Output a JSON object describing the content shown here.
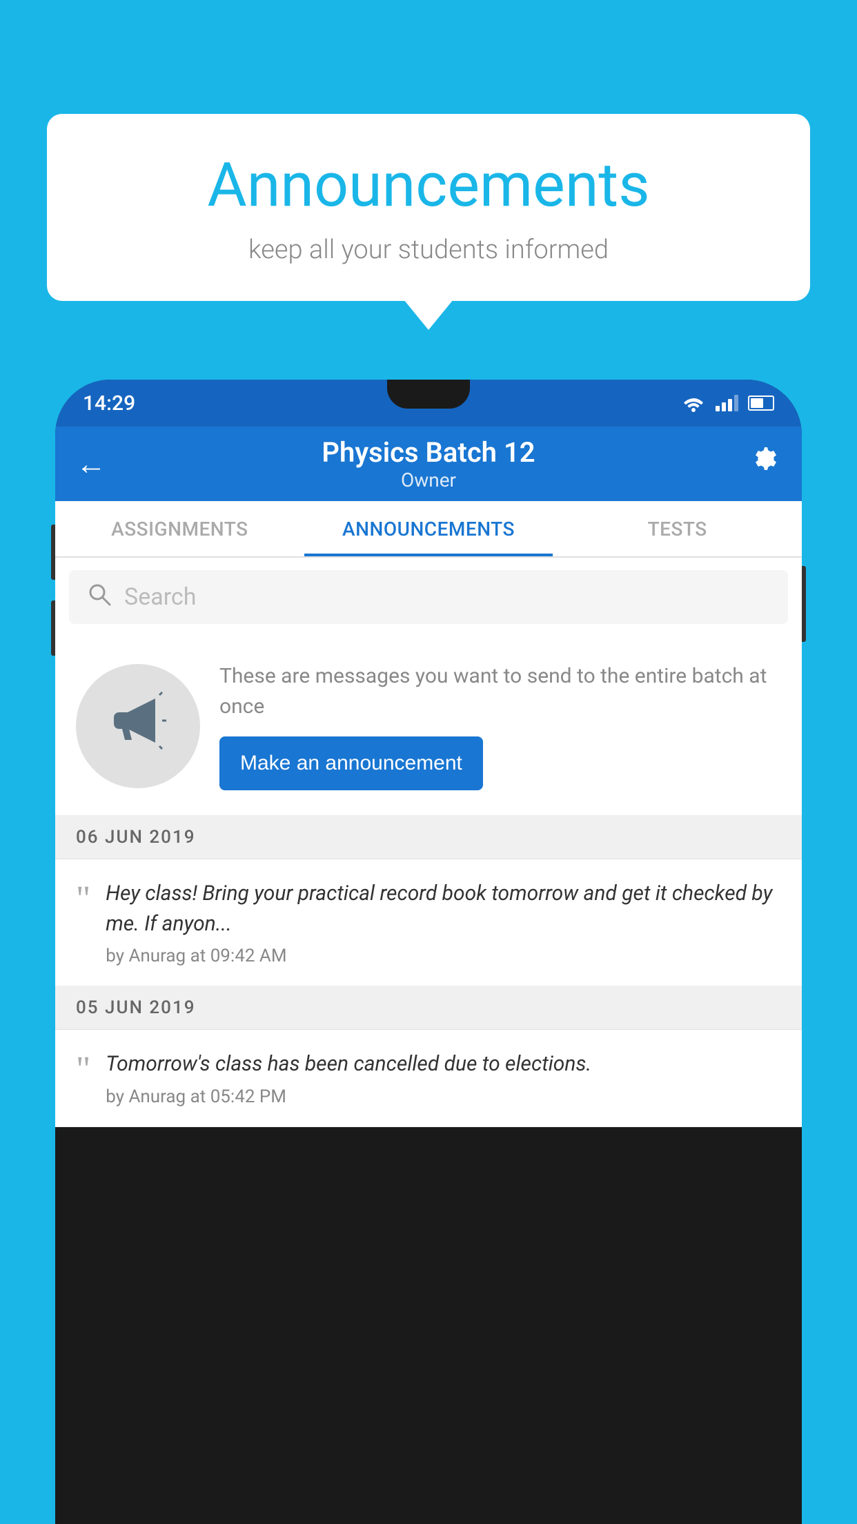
{
  "bubble": {
    "title": "Announcements",
    "subtitle": "keep all your students informed"
  },
  "status_bar": {
    "time": "14:29"
  },
  "app_bar": {
    "title": "Physics Batch 12",
    "subtitle": "Owner",
    "back_label": "←",
    "settings_label": "⚙"
  },
  "tabs": [
    {
      "label": "ASSIGNMENTS",
      "active": false
    },
    {
      "label": "ANNOUNCEMENTS",
      "active": true
    },
    {
      "label": "TESTS",
      "active": false
    }
  ],
  "search": {
    "placeholder": "Search"
  },
  "empty_state": {
    "description": "These are messages you want to\nsend to the entire batch at once",
    "button_label": "Make an announcement"
  },
  "announcements": [
    {
      "date": "06  JUN  2019",
      "text": "Hey class! Bring your practical record book tomorrow and get it checked by me. If anyon...",
      "meta": "by Anurag at 09:42 AM"
    },
    {
      "date": "05  JUN  2019",
      "text": "Tomorrow's class has been cancelled due to elections.",
      "meta": "by Anurag at 05:42 PM"
    }
  ]
}
